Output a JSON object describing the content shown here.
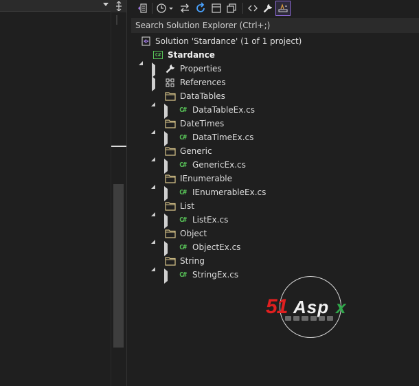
{
  "search": {
    "placeholder": "Search Solution Explorer (Ctrl+;)"
  },
  "solution": {
    "label": "Solution 'Stardance' (1 of 1 project)"
  },
  "project": {
    "label": "Stardance"
  },
  "nodes": {
    "properties": "Properties",
    "references": "References",
    "datatables": "DataTables",
    "datatableex": "DataTableEx.cs",
    "datetimes": "DateTimes",
    "datetimeex": "DataTimeEx.cs",
    "generic": "Generic",
    "genericex": "GenericEx.cs",
    "ienumerable": "IEnumerable",
    "ienumerableex": "IEnumerableEx.cs",
    "list": "List",
    "listex": "ListEx.cs",
    "object": "Object",
    "objectex": "ObjectEx.cs",
    "string": "String",
    "stringex": "StringEx.cs"
  },
  "icons": {
    "cs_file": "C#",
    "cs_project": "C#"
  },
  "watermark": {
    "left": "51",
    "middle": "Asp",
    "right": "x"
  },
  "colors": {
    "csharp_green": "#57c157",
    "folder": "#d8c48a",
    "accent_purple": "#8d6ad8"
  }
}
